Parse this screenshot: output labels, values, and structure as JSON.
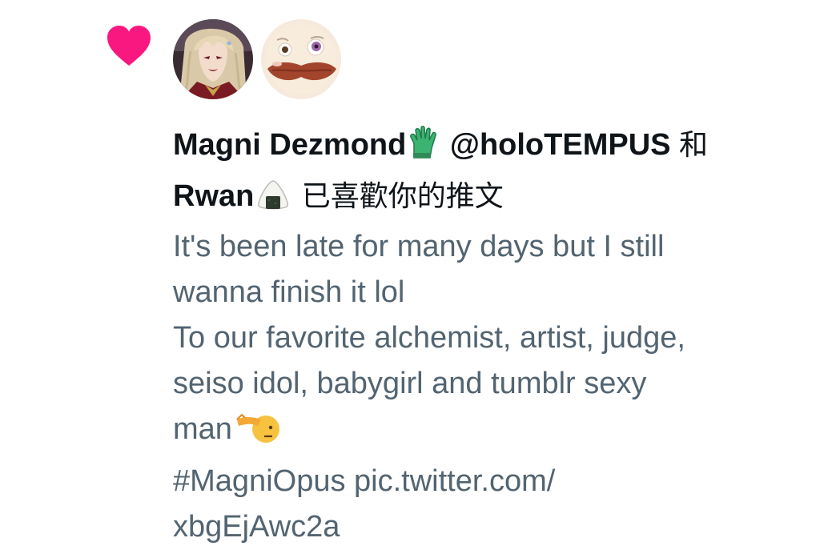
{
  "notification": {
    "type_icon": "heart-icon",
    "accent_color": "#f91880",
    "avatars": [
      {
        "name": "avatar-magni",
        "icon": "anime-character-avatar"
      },
      {
        "name": "avatar-rwan",
        "icon": "cartoon-face-avatar"
      }
    ],
    "headline": {
      "user1_name": "Magni Dezmond",
      "user1_emoji": "green-glove-icon",
      "user1_handle": " @holoTEMPUS ",
      "conjunction": "和",
      "user2_name": "Rwan",
      "user2_emoji": "rice-ball-icon",
      "action": " 已喜歡你的推文"
    },
    "tweet": {
      "lines": [
        "It's been late for many days but I still",
        "wanna finish it lol",
        "To our favorite alchemist, artist, judge,",
        "seiso idol, babygirl and tumblr sexy",
        "man",
        "#MagniOpus pic.twitter.com/",
        "xbgEjAwc2a"
      ],
      "line5_emoji": "saluting-face-icon"
    }
  }
}
